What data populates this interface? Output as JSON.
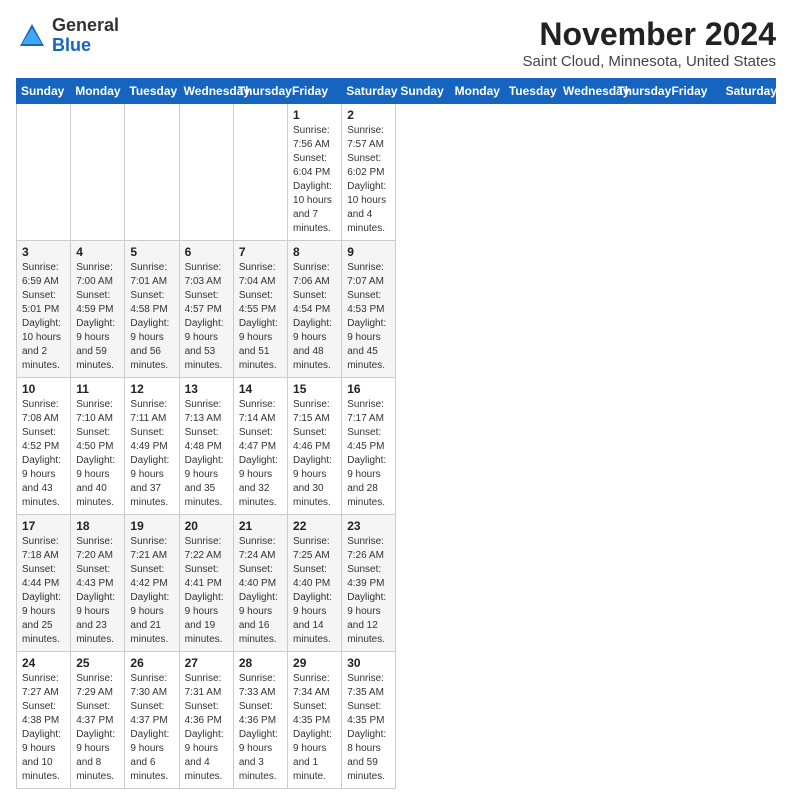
{
  "header": {
    "logo_line1": "General",
    "logo_line2": "Blue",
    "month_title": "November 2024",
    "location": "Saint Cloud, Minnesota, United States"
  },
  "days_of_week": [
    "Sunday",
    "Monday",
    "Tuesday",
    "Wednesday",
    "Thursday",
    "Friday",
    "Saturday"
  ],
  "weeks": [
    [
      {
        "day": "",
        "info": ""
      },
      {
        "day": "",
        "info": ""
      },
      {
        "day": "",
        "info": ""
      },
      {
        "day": "",
        "info": ""
      },
      {
        "day": "",
        "info": ""
      },
      {
        "day": "1",
        "info": "Sunrise: 7:56 AM\nSunset: 6:04 PM\nDaylight: 10 hours and 7 minutes."
      },
      {
        "day": "2",
        "info": "Sunrise: 7:57 AM\nSunset: 6:02 PM\nDaylight: 10 hours and 4 minutes."
      }
    ],
    [
      {
        "day": "3",
        "info": "Sunrise: 6:59 AM\nSunset: 5:01 PM\nDaylight: 10 hours and 2 minutes."
      },
      {
        "day": "4",
        "info": "Sunrise: 7:00 AM\nSunset: 4:59 PM\nDaylight: 9 hours and 59 minutes."
      },
      {
        "day": "5",
        "info": "Sunrise: 7:01 AM\nSunset: 4:58 PM\nDaylight: 9 hours and 56 minutes."
      },
      {
        "day": "6",
        "info": "Sunrise: 7:03 AM\nSunset: 4:57 PM\nDaylight: 9 hours and 53 minutes."
      },
      {
        "day": "7",
        "info": "Sunrise: 7:04 AM\nSunset: 4:55 PM\nDaylight: 9 hours and 51 minutes."
      },
      {
        "day": "8",
        "info": "Sunrise: 7:06 AM\nSunset: 4:54 PM\nDaylight: 9 hours and 48 minutes."
      },
      {
        "day": "9",
        "info": "Sunrise: 7:07 AM\nSunset: 4:53 PM\nDaylight: 9 hours and 45 minutes."
      }
    ],
    [
      {
        "day": "10",
        "info": "Sunrise: 7:08 AM\nSunset: 4:52 PM\nDaylight: 9 hours and 43 minutes."
      },
      {
        "day": "11",
        "info": "Sunrise: 7:10 AM\nSunset: 4:50 PM\nDaylight: 9 hours and 40 minutes."
      },
      {
        "day": "12",
        "info": "Sunrise: 7:11 AM\nSunset: 4:49 PM\nDaylight: 9 hours and 37 minutes."
      },
      {
        "day": "13",
        "info": "Sunrise: 7:13 AM\nSunset: 4:48 PM\nDaylight: 9 hours and 35 minutes."
      },
      {
        "day": "14",
        "info": "Sunrise: 7:14 AM\nSunset: 4:47 PM\nDaylight: 9 hours and 32 minutes."
      },
      {
        "day": "15",
        "info": "Sunrise: 7:15 AM\nSunset: 4:46 PM\nDaylight: 9 hours and 30 minutes."
      },
      {
        "day": "16",
        "info": "Sunrise: 7:17 AM\nSunset: 4:45 PM\nDaylight: 9 hours and 28 minutes."
      }
    ],
    [
      {
        "day": "17",
        "info": "Sunrise: 7:18 AM\nSunset: 4:44 PM\nDaylight: 9 hours and 25 minutes."
      },
      {
        "day": "18",
        "info": "Sunrise: 7:20 AM\nSunset: 4:43 PM\nDaylight: 9 hours and 23 minutes."
      },
      {
        "day": "19",
        "info": "Sunrise: 7:21 AM\nSunset: 4:42 PM\nDaylight: 9 hours and 21 minutes."
      },
      {
        "day": "20",
        "info": "Sunrise: 7:22 AM\nSunset: 4:41 PM\nDaylight: 9 hours and 19 minutes."
      },
      {
        "day": "21",
        "info": "Sunrise: 7:24 AM\nSunset: 4:40 PM\nDaylight: 9 hours and 16 minutes."
      },
      {
        "day": "22",
        "info": "Sunrise: 7:25 AM\nSunset: 4:40 PM\nDaylight: 9 hours and 14 minutes."
      },
      {
        "day": "23",
        "info": "Sunrise: 7:26 AM\nSunset: 4:39 PM\nDaylight: 9 hours and 12 minutes."
      }
    ],
    [
      {
        "day": "24",
        "info": "Sunrise: 7:27 AM\nSunset: 4:38 PM\nDaylight: 9 hours and 10 minutes."
      },
      {
        "day": "25",
        "info": "Sunrise: 7:29 AM\nSunset: 4:37 PM\nDaylight: 9 hours and 8 minutes."
      },
      {
        "day": "26",
        "info": "Sunrise: 7:30 AM\nSunset: 4:37 PM\nDaylight: 9 hours and 6 minutes."
      },
      {
        "day": "27",
        "info": "Sunrise: 7:31 AM\nSunset: 4:36 PM\nDaylight: 9 hours and 4 minutes."
      },
      {
        "day": "28",
        "info": "Sunrise: 7:33 AM\nSunset: 4:36 PM\nDaylight: 9 hours and 3 minutes."
      },
      {
        "day": "29",
        "info": "Sunrise: 7:34 AM\nSunset: 4:35 PM\nDaylight: 9 hours and 1 minute."
      },
      {
        "day": "30",
        "info": "Sunrise: 7:35 AM\nSunset: 4:35 PM\nDaylight: 8 hours and 59 minutes."
      }
    ]
  ]
}
